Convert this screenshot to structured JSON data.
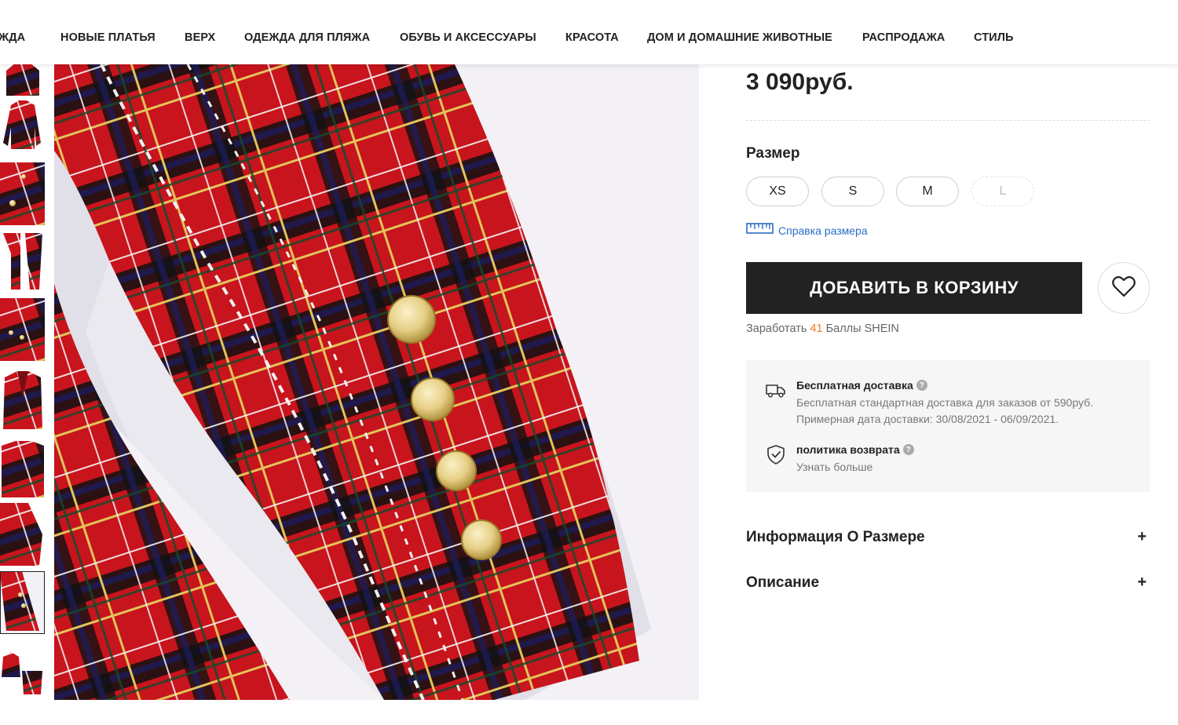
{
  "nav": {
    "items": [
      "ЖДА",
      "НОВЫЕ ПЛАТЬЯ",
      "ВЕРХ",
      "ОДЕЖДА ДЛЯ ПЛЯЖА",
      "ОБУВЬ И АКСЕССУАРЫ",
      "КРАСОТА",
      "ДОМ И ДОМАШНИЕ ЖИВОТНЫЕ",
      "РАСПРОДАЖА",
      "СТИЛЬ"
    ]
  },
  "product": {
    "price": "3 090руб.",
    "size_title": "Размер",
    "sizes": [
      "XS",
      "S",
      "M",
      "L"
    ],
    "size_guide": "Справка размера",
    "add_to_cart": "ДОБАВИТЬ В КОРЗИНУ",
    "points_prefix": "Заработать",
    "points_value": "41",
    "points_suffix": "Баллы SHEIN"
  },
  "shipping": {
    "title": "Бесплатная доставка",
    "line1": "Бесплатная стандартная доставка для заказов от 590руб.",
    "line2": "Примерная дата доставки: 30/08/2021 - 06/09/2021."
  },
  "returns": {
    "title": "политика возврата",
    "link": "Узнать больше"
  },
  "accordions": {
    "size_info": "Информация О Размере",
    "description": "Описание",
    "toggle": "+"
  },
  "colors": {
    "accent_orange": "#f07a1e",
    "link_blue": "#2b6cc4",
    "button_dark": "#222222"
  }
}
